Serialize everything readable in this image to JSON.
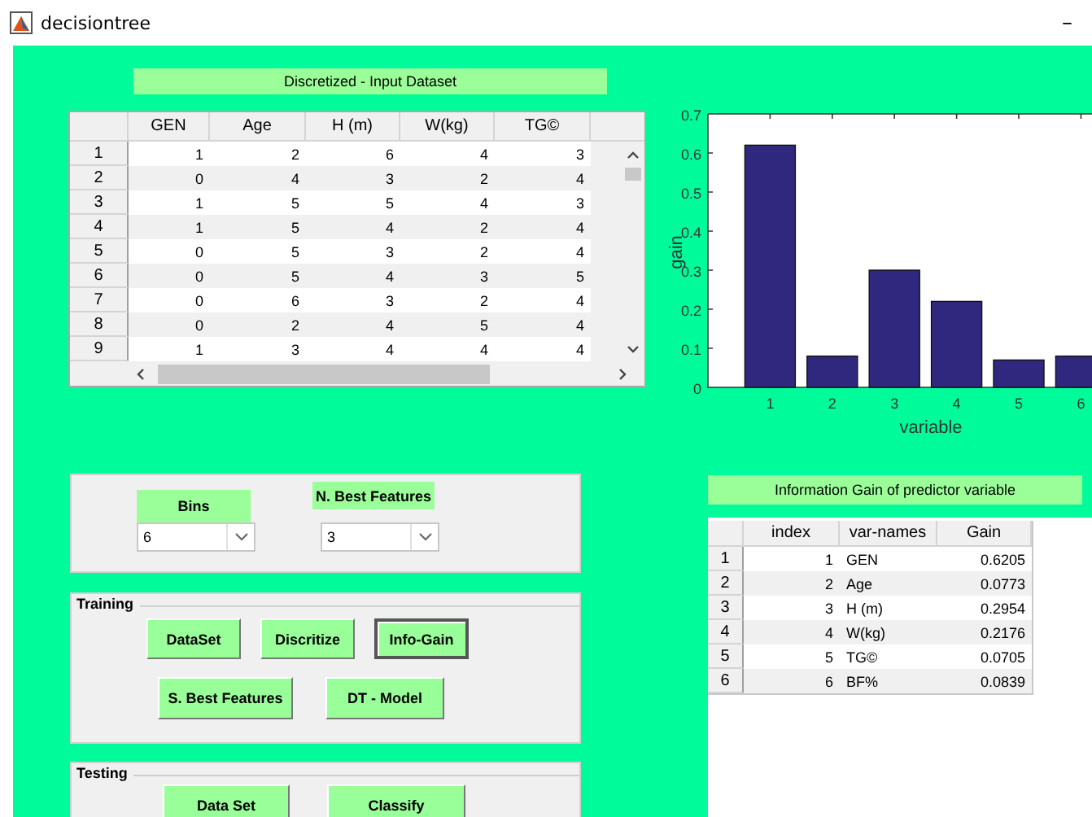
{
  "window": {
    "title": "decisiontree",
    "minimize": "–"
  },
  "dataset": {
    "title": "Discretized -  Input Dataset",
    "columns": [
      "GEN",
      "Age",
      "H (m)",
      "W(kg)",
      "TG©"
    ],
    "rows": [
      {
        "label": "1",
        "cells": [
          "1",
          "2",
          "6",
          "4",
          "3"
        ]
      },
      {
        "label": "2",
        "cells": [
          "0",
          "4",
          "3",
          "2",
          "4"
        ]
      },
      {
        "label": "3",
        "cells": [
          "1",
          "5",
          "5",
          "4",
          "3"
        ]
      },
      {
        "label": "4",
        "cells": [
          "1",
          "5",
          "4",
          "2",
          "4"
        ]
      },
      {
        "label": "5",
        "cells": [
          "0",
          "5",
          "3",
          "2",
          "4"
        ]
      },
      {
        "label": "6",
        "cells": [
          "0",
          "5",
          "4",
          "3",
          "5"
        ]
      },
      {
        "label": "7",
        "cells": [
          "0",
          "6",
          "3",
          "2",
          "4"
        ]
      },
      {
        "label": "8",
        "cells": [
          "0",
          "2",
          "4",
          "5",
          "4"
        ]
      },
      {
        "label": "9",
        "cells": [
          "1",
          "3",
          "4",
          "4",
          "4"
        ]
      }
    ]
  },
  "chart": {
    "chart_data": {
      "type": "bar",
      "xlabel": "variable",
      "ylabel": "gain",
      "categories": [
        "1",
        "2",
        "3",
        "4",
        "5",
        "6"
      ],
      "values": [
        0.62,
        0.08,
        0.3,
        0.22,
        0.07,
        0.08
      ],
      "ylim": [
        0,
        0.7
      ],
      "yticks": [
        0,
        0.1,
        0.2,
        0.3,
        0.4,
        0.5,
        0.6,
        0.7
      ]
    }
  },
  "options": {
    "fields": [
      {
        "label": "Bins",
        "value": "6"
      },
      {
        "label": "N. Best Features",
        "value": "3"
      }
    ]
  },
  "training": {
    "title": "Training",
    "button_rows": [
      [
        {
          "label": "DataSet",
          "selected": false
        },
        {
          "label": "Discritize",
          "selected": false
        },
        {
          "label": "Info-Gain",
          "selected": true
        }
      ],
      [
        {
          "label": "S. Best Features",
          "selected": false
        },
        {
          "label": "DT - Model",
          "selected": false
        }
      ]
    ]
  },
  "testing": {
    "title": "Testing",
    "button_rows": [
      [
        {
          "label": "Data Set",
          "selected": false
        },
        {
          "label": "Classify",
          "selected": false
        }
      ]
    ]
  },
  "info_gain": {
    "title": "Information Gain of predictor variable",
    "columns": [
      "index",
      "var-names",
      "Gain"
    ],
    "rows": [
      {
        "label": "1",
        "cells": [
          "1",
          "GEN",
          "0.6205"
        ]
      },
      {
        "label": "2",
        "cells": [
          "2",
          "Age",
          "0.0773"
        ]
      },
      {
        "label": "3",
        "cells": [
          "3",
          "H (m)",
          "0.2954"
        ]
      },
      {
        "label": "4",
        "cells": [
          "4",
          "W(kg)",
          "0.2176"
        ]
      },
      {
        "label": "5",
        "cells": [
          "5",
          "TG©",
          "0.0705"
        ]
      },
      {
        "label": "6",
        "cells": [
          "6",
          "BF%",
          "0.0839"
        ]
      }
    ]
  }
}
